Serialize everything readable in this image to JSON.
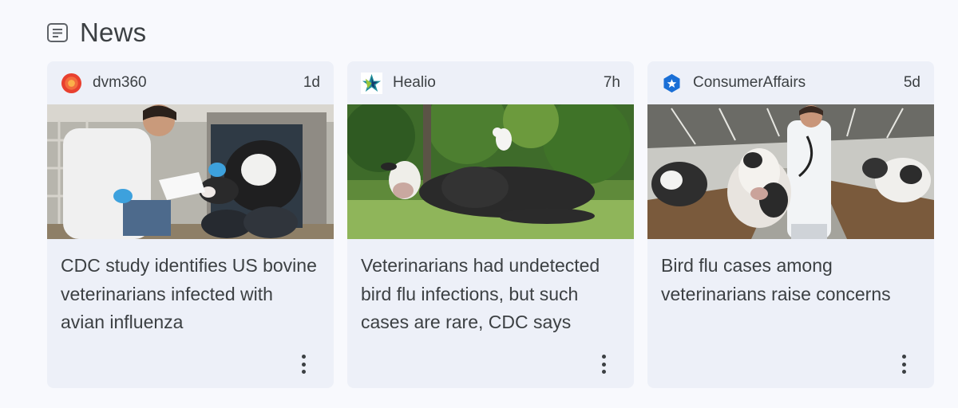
{
  "section": {
    "title": "News",
    "icon": "news-icon"
  },
  "cards": [
    {
      "source": "dvm360",
      "source_icon": "dvm360-logo-icon",
      "time": "1d",
      "headline": "CDC study identifies US bovine veterinarians infected with avian influenza"
    },
    {
      "source": "Healio",
      "source_icon": "healio-logo-icon",
      "time": "7h",
      "headline": "Veterinarians had undetected bird flu infections, but such cases are rare, CDC says"
    },
    {
      "source": "ConsumerAffairs",
      "source_icon": "consumeraffairs-logo-icon",
      "time": "5d",
      "headline": "Bird flu cases among veterinarians raise concerns"
    }
  ],
  "colors": {
    "background": "#f8f9fd",
    "card": "#edf0f8",
    "text": "#3c4043",
    "dvm360": "#e8402f",
    "consumeraffairs": "#1a6fd6"
  }
}
